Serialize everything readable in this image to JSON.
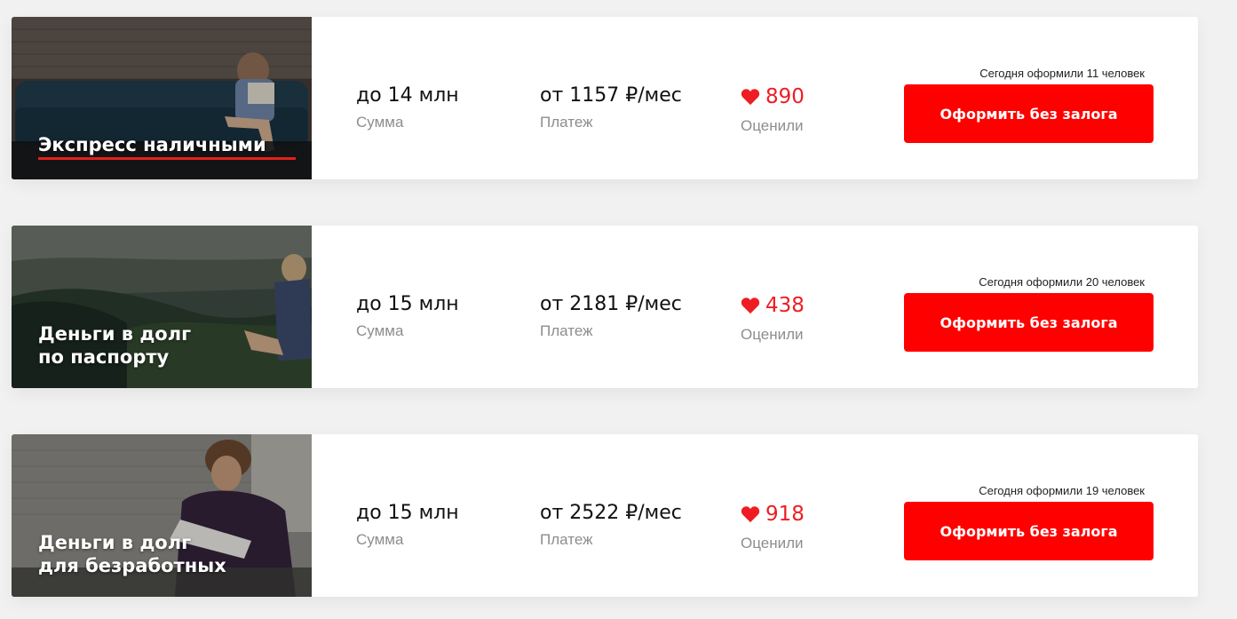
{
  "offers": [
    {
      "title_lines": [
        "Экспресс наличными"
      ],
      "amount": "до 14 млн",
      "amount_label": "Сумма",
      "payment": "от 1157 ₽/мес",
      "payment_label": "Платеж",
      "rating": "890",
      "rating_label": "Оценили",
      "today_note": "Сегодня оформили 11 человек",
      "button_label": "Оформить без залога"
    },
    {
      "title_lines": [
        "Деньги в долг",
        "по паспорту"
      ],
      "amount": "до 15 млн",
      "amount_label": "Сумма",
      "payment": "от 2181 ₽/мес",
      "payment_label": "Платеж",
      "rating": "438",
      "rating_label": "Оценили",
      "today_note": "Сегодня оформили 20 человек",
      "button_label": "Оформить без залога"
    },
    {
      "title_lines": [
        "Деньги в долг",
        "для безработных"
      ],
      "amount": "до 15 млн",
      "amount_label": "Сумма",
      "payment": "от 2522 ₽/мес",
      "payment_label": "Платеж",
      "rating": "918",
      "rating_label": "Оценили",
      "today_note": "Сегодня оформили 19 человек",
      "button_label": "Оформить без залога"
    }
  ],
  "icons": {
    "rating": "heart-icon"
  },
  "colors": {
    "accent": "#ff0000",
    "rating": "#ee1d23",
    "muted_text": "#8d8d8d",
    "background": "#f1f1f1"
  }
}
